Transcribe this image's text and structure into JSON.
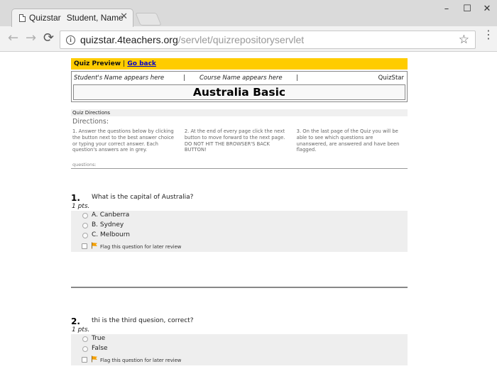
{
  "browser": {
    "tab_title_prefix": "Quizstar",
    "tab_title_rest": "Student, Name",
    "tab_close": "✕",
    "url_host": "quizstar.4teachers.org",
    "url_path": "/servlet/quizrepositoryservlet",
    "window_minimize": "–",
    "window_maximize": "☐",
    "window_close": "✕",
    "back": "←",
    "forward": "→",
    "reload": "⟳",
    "star": "☆",
    "menu": "⋮",
    "info": "i"
  },
  "preview": {
    "label": "Quiz Preview",
    "separator": "|",
    "go_back": "Go back"
  },
  "header": {
    "student": "Student's Name appears here",
    "sep1": "|",
    "course": "Course Name appears here",
    "sep2": "|",
    "brand": "QuizStar",
    "quiz_title": "Australia Basic"
  },
  "directions": {
    "section_label": "Quiz Directions",
    "title": "Directions:",
    "col1": "1. Answer the questions below by clicking the button next to the best answer choice or typing your correct answer. Each question's answers are in grey.",
    "col2": "2. At the end of every page click the next button to move forward to the next page. DO NOT HIT THE BROWSER'S BACK BUTTON!",
    "col3": "3. On the last page of the Quiz you will be able to see which questions are unanswered, are answered and have been flagged.",
    "questions_label": "questions:"
  },
  "questions": [
    {
      "number": "1.",
      "text": "What is the capital of Australia?",
      "points": "1 pts.",
      "answers": [
        "A.  Canberra",
        "B.  Sydney",
        "C.  Melbourn"
      ],
      "flag_label": "Flag this question for later review"
    },
    {
      "number": "2.",
      "text": "thi is the third quesion, correct?",
      "points": "1 pts.",
      "answers": [
        "True",
        "False"
      ],
      "flag_label": "Flag this question for later review"
    }
  ],
  "colors": {
    "preview_bar": "#ffcc00",
    "flag": "#f5a000",
    "answer_bg": "#eeeeee"
  }
}
